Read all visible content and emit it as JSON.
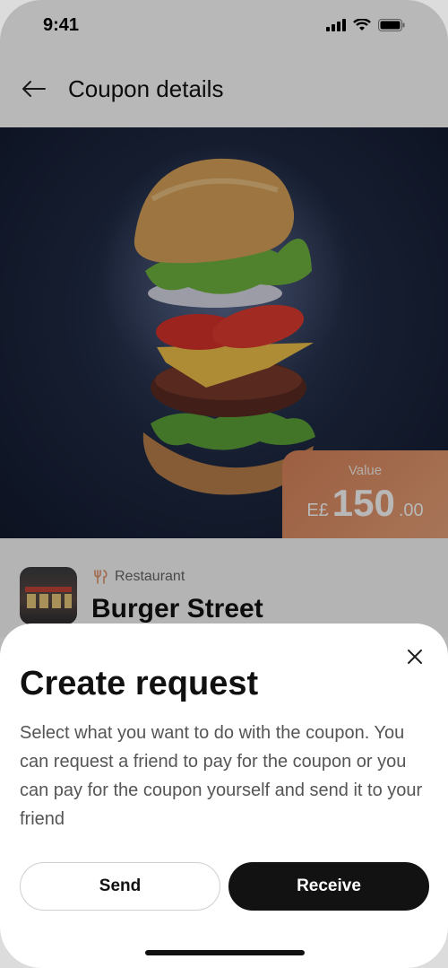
{
  "status": {
    "time": "9:41"
  },
  "header": {
    "title": "Coupon details"
  },
  "coupon": {
    "value_label": "Value",
    "currency": "E£",
    "amount_main": "150",
    "amount_decimals": ".00"
  },
  "store": {
    "category": "Restaurant",
    "name": "Burger Street"
  },
  "sheet": {
    "title": "Create request",
    "description": "Select what you want to do with the coupon. You can request a friend to pay for the coupon or you can pay for the coupon yourself and send it to your friend",
    "send_label": "Send",
    "receive_label": "Receive"
  },
  "colors": {
    "accent": "#e0916a",
    "primary_button": "#121212",
    "hero_bg": "#1f2a44"
  }
}
